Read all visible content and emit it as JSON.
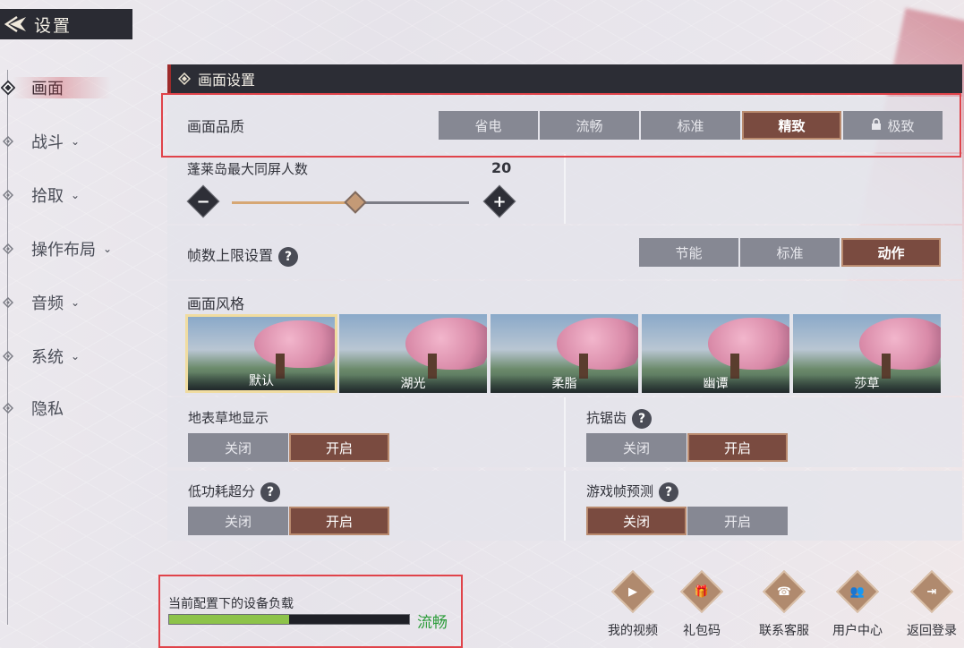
{
  "header": {
    "title": "设置",
    "back_icon": "back-arrow-icon"
  },
  "sidebar": {
    "items": [
      {
        "label": "画面",
        "chevron": "",
        "active": true
      },
      {
        "label": "战斗",
        "chevron": "⌄",
        "active": false
      },
      {
        "label": "拾取",
        "chevron": "⌄",
        "active": false
      },
      {
        "label": "操作布局",
        "chevron": "⌄",
        "active": false
      },
      {
        "label": "音频",
        "chevron": "⌄",
        "active": false
      },
      {
        "label": "系统",
        "chevron": "⌄",
        "active": false
      },
      {
        "label": "隐私",
        "chevron": "",
        "active": false
      }
    ]
  },
  "section": {
    "title": "画面设置"
  },
  "quality": {
    "label": "画面品质",
    "options": [
      "省电",
      "流畅",
      "标准",
      "精致",
      "极致"
    ],
    "selected": "精致",
    "locked": "极致"
  },
  "crowd": {
    "label": "蓬莱岛最大同屏人数",
    "value": "20",
    "fraction": 0.52,
    "minus": "−",
    "plus": "+"
  },
  "fps": {
    "label": "帧数上限设置",
    "help": "?",
    "options": [
      "节能",
      "标准",
      "动作"
    ],
    "selected": "动作"
  },
  "style": {
    "label": "画面风格",
    "options": [
      "默认",
      "湖光",
      "柔脂",
      "幽谭",
      "莎草"
    ],
    "selected": "默认"
  },
  "grass": {
    "label": "地表草地显示",
    "off": "关闭",
    "on": "开启",
    "selected": "开启"
  },
  "aa": {
    "label": "抗锯齿",
    "help": "?",
    "off": "关闭",
    "on": "开启",
    "selected": "开启"
  },
  "upscale": {
    "label": "低功耗超分",
    "help": "?",
    "off": "关闭",
    "on": "开启",
    "selected": "开启"
  },
  "framepred": {
    "label": "游戏帧预测",
    "help": "?",
    "off": "关闭",
    "on": "开启",
    "selected": "关闭"
  },
  "load": {
    "label": "当前配置下的设备负载",
    "status": "流畅",
    "fraction": 0.5,
    "status_color": "#2c9c3a"
  },
  "bottom": [
    {
      "label": "我的视频",
      "icon": "play-icon",
      "glyph": "▶"
    },
    {
      "label": "礼包码",
      "icon": "gift-icon",
      "glyph": "🎁"
    },
    {
      "label": "联系客服",
      "icon": "headset-icon",
      "glyph": "☎"
    },
    {
      "label": "用户中心",
      "icon": "users-icon",
      "glyph": "👥"
    },
    {
      "label": "返回登录",
      "icon": "logout-icon",
      "glyph": "⇥"
    }
  ],
  "colors": {
    "accent": "#7a4b40",
    "header_bg": "#2a2b33",
    "highlight": "#e0434a"
  }
}
